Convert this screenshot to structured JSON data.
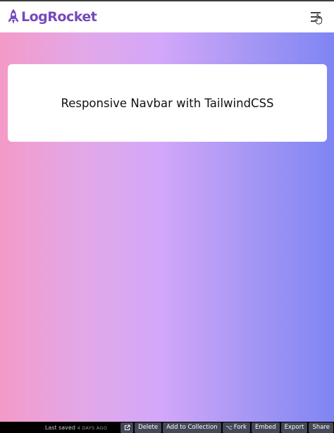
{
  "navbar": {
    "brand": "LogRocket",
    "brand_color": "#764abc",
    "menu_icon": "hamburger-menu-icon"
  },
  "hero": {
    "gradient_colors": [
      "#f49ac8",
      "#d3a7f9",
      "#7f85f3"
    ],
    "card_title": "Responsive Navbar with TailwindCSS"
  },
  "footer": {
    "last_saved_label": "Last saved",
    "last_saved_ago": "4 DAYS AGO",
    "open_icon": "external-link-icon",
    "buttons": {
      "delete": "Delete",
      "add_to_collection": "Add to Collection",
      "fork": "Fork",
      "embed": "Embed",
      "export": "Export",
      "share": "Share"
    }
  }
}
